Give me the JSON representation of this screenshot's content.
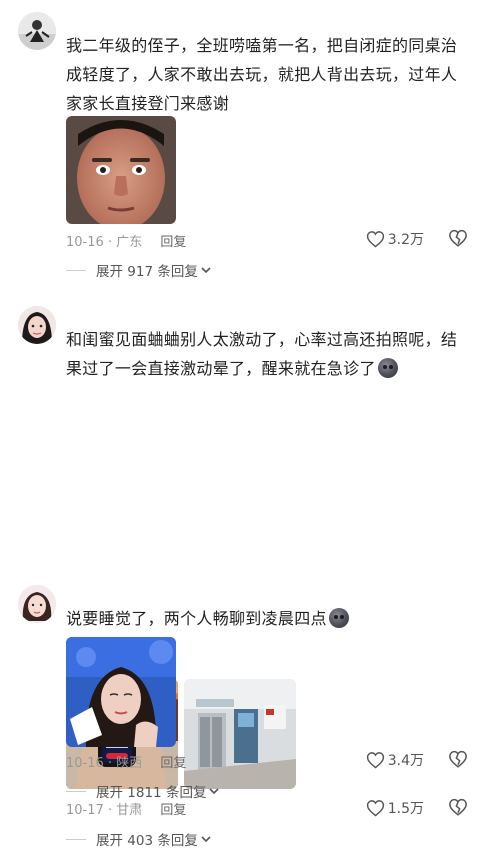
{
  "comments": [
    {
      "text": "我二年级的侄子，全班唠嗑第一名，把自闭症的同桌治成轻度了，人家不敢出去玩，就把人背出去玩，过年人家家长直接登门来感谢",
      "date": "10-16",
      "location": "广东",
      "reply_label": "回复",
      "likes": "3.2万",
      "expand_label": "展开 917 条回复"
    },
    {
      "text": "和闺蜜见面蛐蛐别人太激动了，心率过高还拍照呢，结果过了一会直接激动晕了，醒来就在急诊了",
      "date": "10-17",
      "location": "甘肃",
      "reply_label": "回复",
      "likes": "1.5万",
      "expand_label": "展开 403 条回复"
    },
    {
      "text": "说要睡觉了，两个人畅聊到凌晨四点",
      "date": "10-16",
      "location": "陕西",
      "reply_label": "回复",
      "likes": "3.4万",
      "expand_label": "展开 1811 条回复"
    }
  ],
  "icons": {
    "like": "heart-outline-icon",
    "dislike": "broken-heart-icon",
    "emoji": "dizzy-face-emoji-icon",
    "expand": "chevron-down-icon"
  },
  "colors": {
    "text": "#222222",
    "meta": "#999999",
    "icon": "#555555"
  }
}
